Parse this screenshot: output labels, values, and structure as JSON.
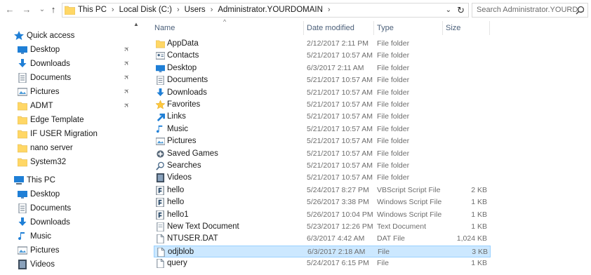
{
  "nav_buttons": {
    "back": "←",
    "forward": "→",
    "recent": "⌄",
    "up": "↑"
  },
  "address": {
    "crumbs": [
      "This PC",
      "Local Disk (C:)",
      "Users",
      "Administrator.YOURDOMAIN"
    ],
    "separator": "›",
    "dropdown": "⌄",
    "refresh": "↻"
  },
  "search": {
    "placeholder": "Search Administrator.YOURD..."
  },
  "nav_pane": {
    "quick_access": "Quick access",
    "quick_items": [
      {
        "label": "Desktop",
        "icon": "desktop-icon",
        "pinned": true
      },
      {
        "label": "Downloads",
        "icon": "downloads-icon",
        "pinned": true
      },
      {
        "label": "Documents",
        "icon": "documents-icon",
        "pinned": true
      },
      {
        "label": "Pictures",
        "icon": "pictures-icon",
        "pinned": true
      },
      {
        "label": "ADMT",
        "icon": "folder-icon",
        "pinned": true
      },
      {
        "label": "Edge Template",
        "icon": "folder-icon",
        "pinned": false
      },
      {
        "label": "IF USER Migration",
        "icon": "folder-icon",
        "pinned": false
      },
      {
        "label": "nano server",
        "icon": "folder-icon",
        "pinned": false
      },
      {
        "label": "System32",
        "icon": "folder-icon",
        "pinned": false
      }
    ],
    "this_pc": "This PC",
    "pc_items": [
      {
        "label": "Desktop",
        "icon": "desktop-icon"
      },
      {
        "label": "Documents",
        "icon": "documents-icon"
      },
      {
        "label": "Downloads",
        "icon": "downloads-icon"
      },
      {
        "label": "Music",
        "icon": "music-icon"
      },
      {
        "label": "Pictures",
        "icon": "pictures-icon"
      },
      {
        "label": "Videos",
        "icon": "videos-icon"
      }
    ]
  },
  "columns": {
    "name": "Name",
    "date": "Date modified",
    "type": "Type",
    "size": "Size"
  },
  "files": [
    {
      "name": "AppData",
      "date": "2/12/2017 2:11 PM",
      "type": "File folder",
      "size": "",
      "icon": "folder-icon"
    },
    {
      "name": "Contacts",
      "date": "5/21/2017 10:57 AM",
      "type": "File folder",
      "size": "",
      "icon": "contacts-icon"
    },
    {
      "name": "Desktop",
      "date": "6/3/2017 2:11 AM",
      "type": "File folder",
      "size": "",
      "icon": "desktop-icon"
    },
    {
      "name": "Documents",
      "date": "5/21/2017 10:57 AM",
      "type": "File folder",
      "size": "",
      "icon": "documents-icon"
    },
    {
      "name": "Downloads",
      "date": "5/21/2017 10:57 AM",
      "type": "File folder",
      "size": "",
      "icon": "downloads-icon"
    },
    {
      "name": "Favorites",
      "date": "5/21/2017 10:57 AM",
      "type": "File folder",
      "size": "",
      "icon": "favorites-icon"
    },
    {
      "name": "Links",
      "date": "5/21/2017 10:57 AM",
      "type": "File folder",
      "size": "",
      "icon": "links-icon"
    },
    {
      "name": "Music",
      "date": "5/21/2017 10:57 AM",
      "type": "File folder",
      "size": "",
      "icon": "music-icon"
    },
    {
      "name": "Pictures",
      "date": "5/21/2017 10:57 AM",
      "type": "File folder",
      "size": "",
      "icon": "pictures-icon"
    },
    {
      "name": "Saved Games",
      "date": "5/21/2017 10:57 AM",
      "type": "File folder",
      "size": "",
      "icon": "saved-games-icon"
    },
    {
      "name": "Searches",
      "date": "5/21/2017 10:57 AM",
      "type": "File folder",
      "size": "",
      "icon": "searches-icon"
    },
    {
      "name": "Videos",
      "date": "5/21/2017 10:57 AM",
      "type": "File folder",
      "size": "",
      "icon": "videos-icon"
    },
    {
      "name": "hello",
      "date": "5/24/2017 8:27 PM",
      "type": "VBScript Script File",
      "size": "2 KB",
      "icon": "script-icon"
    },
    {
      "name": "hello",
      "date": "5/26/2017 3:38 PM",
      "type": "Windows Script File",
      "size": "1 KB",
      "icon": "script-icon"
    },
    {
      "name": "hello1",
      "date": "5/26/2017 10:04 PM",
      "type": "Windows Script File",
      "size": "1 KB",
      "icon": "script-icon"
    },
    {
      "name": "New Text Document",
      "date": "5/23/2017 12:26 PM",
      "type": "Text Document",
      "size": "1 KB",
      "icon": "text-file-icon"
    },
    {
      "name": "NTUSER.DAT",
      "date": "6/3/2017 4:42 AM",
      "type": "DAT File",
      "size": "1,024 KB",
      "icon": "blank-file-icon"
    },
    {
      "name": "odjblob",
      "date": "6/3/2017 2:18 AM",
      "type": "File",
      "size": "3 KB",
      "icon": "blank-file-icon",
      "selected": true
    },
    {
      "name": "query",
      "date": "5/24/2017 6:15 PM",
      "type": "File",
      "size": "1 KB",
      "icon": "blank-file-icon"
    }
  ],
  "colors": {
    "selection": "#cce8ff",
    "selection_border": "#99d1ff",
    "folder": "#ffd766",
    "header_text": "#4c607a"
  }
}
